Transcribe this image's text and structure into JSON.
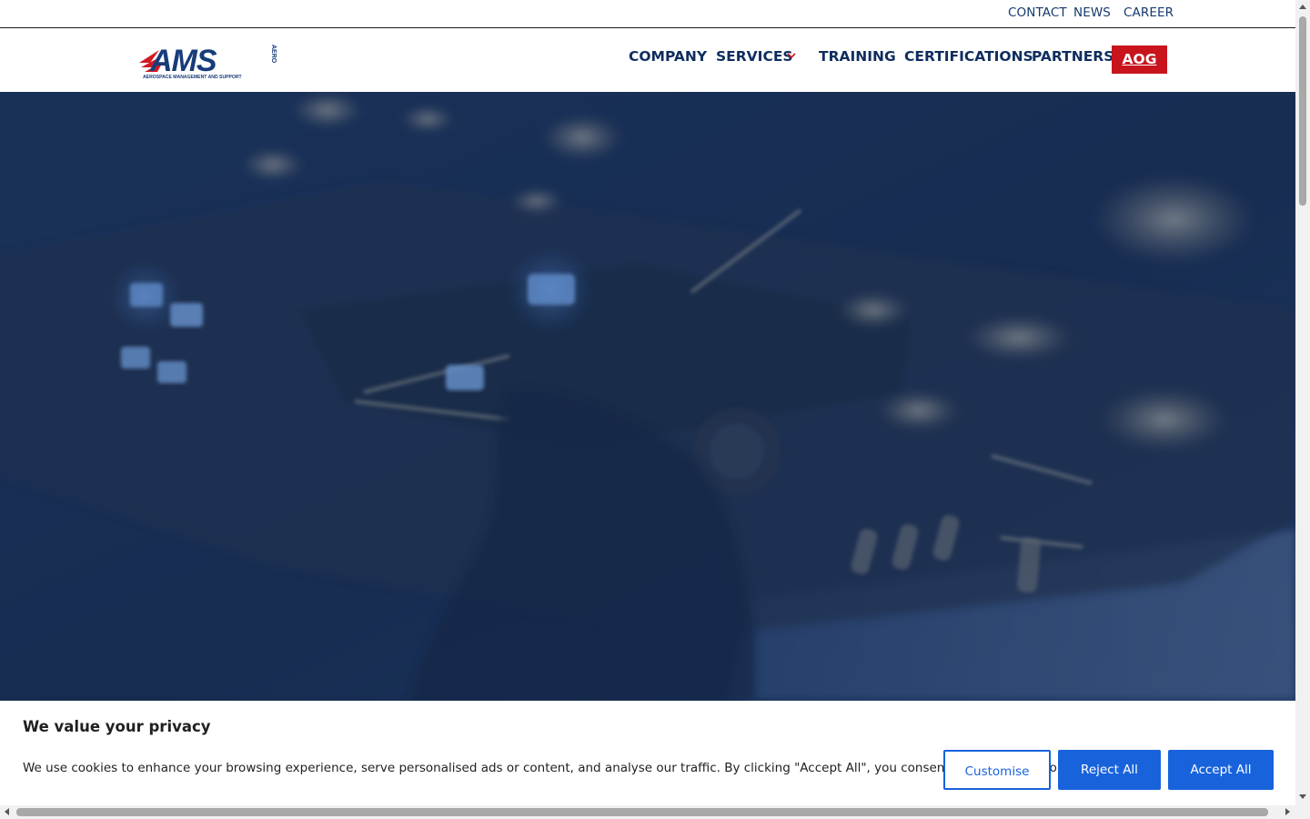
{
  "utility_nav": {
    "contact": "CONTACT",
    "news": "NEWS",
    "career": "CAREER"
  },
  "logo": {
    "text": "AMS",
    "suffix": "AERO",
    "tagline": "AEROSPACE MANAGEMENT AND SUPPORT",
    "icon": "ams-aero-logo"
  },
  "main_nav": {
    "company": "COMPANY",
    "services": "SERVICES",
    "training": "TRAINING",
    "certifications": "CERTIFICATIONS",
    "partners": "PARTNERS",
    "aog": "AOG"
  },
  "colors": {
    "brand_navy": "#0f2d5e",
    "brand_red": "#c8141d",
    "cookie_blue": "#1863dc"
  },
  "cookie": {
    "title": "We value your privacy",
    "text": "We use cookies to enhance your browsing experience, serve personalised ads or content, and analyse our traffic. By clicking \"Accept All\", you consent to our use of cookies.",
    "customise": "Customise",
    "reject": "Reject All",
    "accept": "Accept All"
  }
}
